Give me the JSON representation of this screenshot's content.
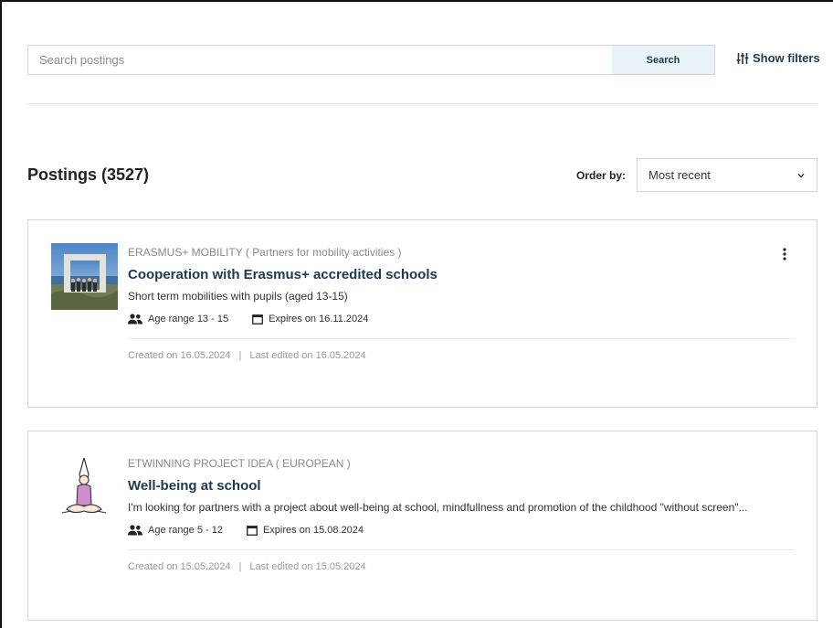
{
  "search": {
    "placeholder": "Search postings",
    "button_label": "Search",
    "filters_label": "Show filters"
  },
  "list": {
    "title": "Postings (3527)",
    "order_label": "Order by:",
    "order_value": "Most recent"
  },
  "postings": [
    {
      "category": "ERASMUS+ MOBILITY ( Partners for mobility activities )",
      "title": "Cooperation with Erasmus+ accredited schools",
      "description": "Short term mobilities with pupils (aged 13-15)",
      "age_range": "Age range 13 - 15",
      "expires": "Expires on 16.11.2024",
      "created": "Created on 16.05.2024",
      "edited": "Last edited on 16.05.2024",
      "separator": "|"
    },
    {
      "category": "ETWINNING PROJECT IDEA ( EUROPEAN )",
      "title": "Well-being at school",
      "description": "I'm looking for partners with a project about well-being at school, mindfullness and promotion of the childhood \"without screen\"...",
      "age_range": "Age range 5 - 12",
      "expires": "Expires on 15.08.2024",
      "created": "Created on 15.05.2024",
      "edited": "Last edited on 15.05.2024",
      "separator": "|"
    }
  ],
  "icons": {
    "filters": "sliders-icon",
    "order_select": "chevron-down-icon",
    "age": "people-icon",
    "expires": "calendar-icon",
    "menu": "more-vertical-icon"
  },
  "colors": {
    "accent": "#1d3a4e",
    "search_button_bg": "#e8f3f7",
    "border": "#cfd6dc",
    "muted_text": "#8a8a8a"
  }
}
